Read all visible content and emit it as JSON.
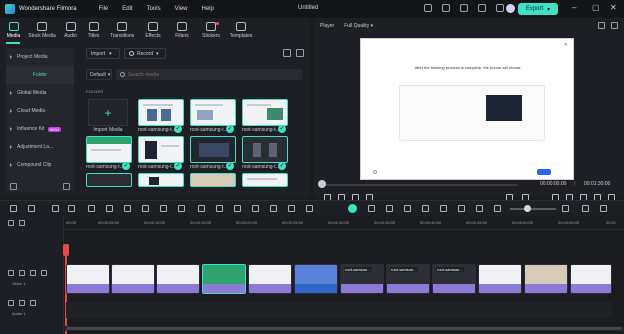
{
  "app": {
    "name": "Wondershare Filmora",
    "document_title": "Untitled",
    "menu": [
      "File",
      "Edit",
      "Tools",
      "View",
      "Help"
    ],
    "export_label": "Export",
    "accent_color": "#3fe0c4"
  },
  "media_tabs": [
    {
      "label": "Media",
      "icon": "folder-icon",
      "active": true
    },
    {
      "label": "Stock Media",
      "icon": "cloud-icon"
    },
    {
      "label": "Audio",
      "icon": "music-note-icon"
    },
    {
      "label": "Titles",
      "icon": "text-icon"
    },
    {
      "label": "Transitions",
      "icon": "transition-icon"
    },
    {
      "label": "Effects",
      "icon": "sparkle-icon"
    },
    {
      "label": "Filters",
      "icon": "filter-icon"
    },
    {
      "label": "Stickers",
      "icon": "sticker-icon"
    },
    {
      "label": "Templates",
      "icon": "template-icon"
    }
  ],
  "sidebar": {
    "items": [
      {
        "label": "Project Media"
      },
      {
        "label": "Folder"
      },
      {
        "label": "Global Media"
      },
      {
        "label": "Cloud Media"
      },
      {
        "label": "Influence Kit",
        "badge": "NEW"
      },
      {
        "label": "Adjustment La..."
      },
      {
        "label": "Compound Clip"
      }
    ]
  },
  "media_toolbar": {
    "import_label": "Import",
    "record_label": "Record",
    "sort_label": "Default",
    "search_placeholder": "Search media",
    "folder_label": "FOLDER"
  },
  "media_items": [
    {
      "label": "Import Media"
    },
    {
      "label": "root-samsung-t..."
    },
    {
      "label": "root-samsung-t..."
    },
    {
      "label": "root-samsung-t..."
    },
    {
      "label": "root-samsung-t..."
    },
    {
      "label": "root-samsung-t..."
    },
    {
      "label": "root-samsung-t..."
    },
    {
      "label": "root-samsung-t..."
    }
  ],
  "player": {
    "label": "Player",
    "quality": "Full Quality",
    "current_time": "00:00:00:00",
    "separator": "/",
    "total_time": "00:01:30:00",
    "preview_title": "After the flashing process is complete, the phone will restart."
  },
  "timeline": {
    "ruler_labels": [
      "00:00",
      "00:00:05:00",
      "00:00:10:00",
      "00:00:15:00",
      "00:00:20:00",
      "00:00:25:00",
      "00:00:30:00",
      "00:00:35:00",
      "00:00:40:00",
      "00:00:45:00",
      "00:00:50:00",
      "00:00:55:00",
      "00:01"
    ],
    "video_track_label": "Video 1",
    "audio_track_label": "Audio 1",
    "clip_labels": [
      "",
      "",
      "",
      "",
      "",
      "",
      "root-samsun...",
      "root-samsun...",
      "root-samsun...",
      "",
      "",
      "",
      ""
    ]
  }
}
